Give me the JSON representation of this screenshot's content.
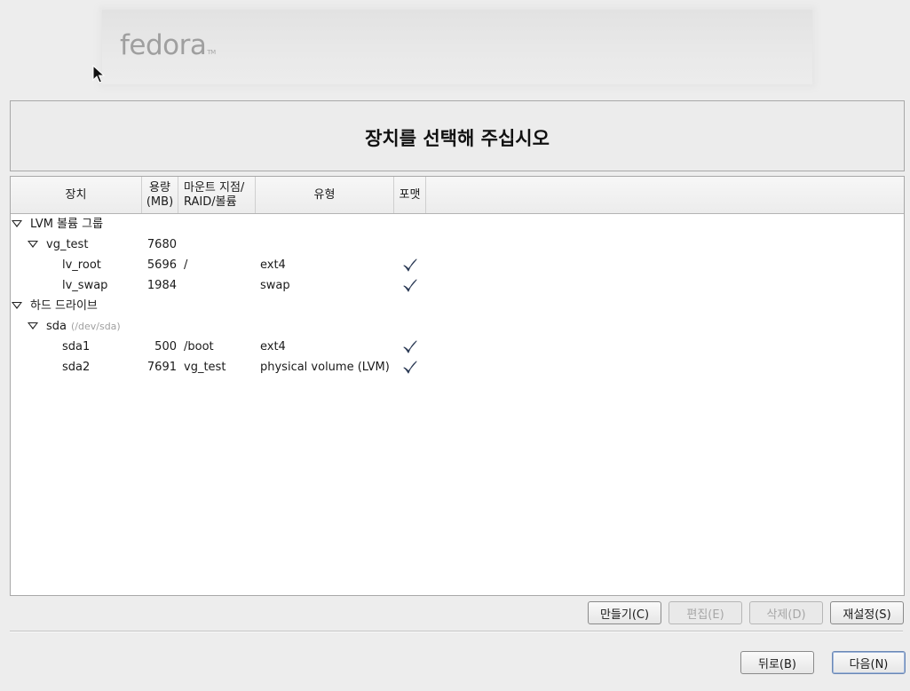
{
  "banner": {
    "logo_text": "fedora",
    "logo_tm": "TM"
  },
  "page_title": "장치를 선택해 주십시오",
  "columns": {
    "device": "장치",
    "size_line1": "용량",
    "size_line2": "(MB)",
    "mount_line1": "마운트 지점/",
    "mount_line2": "RAID/볼륨",
    "type": "유형",
    "format": "포맷"
  },
  "rows": [
    {
      "name": "LVM 볼륨 그룹",
      "level": 0,
      "expander": true,
      "size": "",
      "mount": "",
      "type": "",
      "format": false
    },
    {
      "name": "vg_test",
      "level": 1,
      "expander": true,
      "size": "7680",
      "mount": "",
      "type": "",
      "format": false
    },
    {
      "name": "lv_root",
      "level": 2,
      "expander": false,
      "size": "5696",
      "mount": "/",
      "type": "ext4",
      "format": true
    },
    {
      "name": "lv_swap",
      "level": 2,
      "expander": false,
      "size": "1984",
      "mount": "",
      "type": "swap",
      "format": true
    },
    {
      "name": "하드 드라이브",
      "level": 0,
      "expander": true,
      "size": "",
      "mount": "",
      "type": "",
      "format": false
    },
    {
      "name": "sda",
      "hint": "(/dev/sda)",
      "level": 1,
      "expander": true,
      "size": "",
      "mount": "",
      "type": "",
      "format": false
    },
    {
      "name": "sda1",
      "level": 2,
      "expander": false,
      "size": "500",
      "mount": "/boot",
      "type": "ext4",
      "format": true
    },
    {
      "name": "sda2",
      "level": 2,
      "expander": false,
      "size": "7691",
      "mount": "vg_test",
      "type": "physical volume (LVM)",
      "format": true
    }
  ],
  "actions": {
    "create": "만들기(C)",
    "edit": "편집(E)",
    "delete": "삭제(D)",
    "reset": "재설정(S)"
  },
  "nav": {
    "back": "뒤로(B)",
    "next": "다음(N)"
  },
  "colors": {
    "check": "#2b3a55",
    "default_button_border": "#6a87b5"
  }
}
